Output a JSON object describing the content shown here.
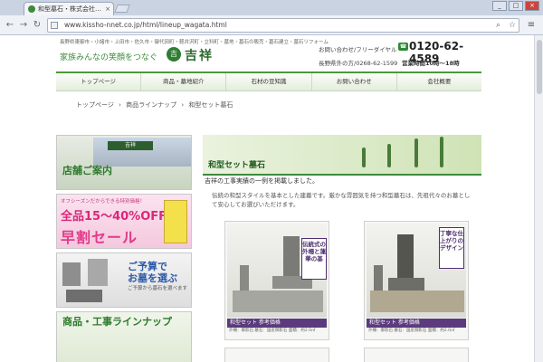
{
  "browser": {
    "tab_title": "和型墓石・株式会社…",
    "tab_close": "×",
    "url": "www.kissho-nnet.co.jp/html/lineup_wagata.html",
    "nav": {
      "back": "←",
      "forward": "→",
      "reload": "↻"
    },
    "window": {
      "minimize": "_",
      "maximize": "□",
      "close": "×"
    }
  },
  "site": {
    "tagline_small": "長野県東御市・小諸市・上田市・佐久市・御代田町・軽井沢町・立科町・墓地・墓石の販売・墓石建立・墓石リフォーム",
    "slogan": "家族みんなの笑顔をつなぐ",
    "logo_mark": "吉",
    "logo_text": "吉祥",
    "phone_label": "お問い合わせ/フリーダイヤル",
    "phone_icon": "☎",
    "phone_number": "0120-62-4589",
    "store_info": "長野県外の方/0268-62-1599",
    "store_hours": "営業時間10時〜18時",
    "nav": [
      "トップページ",
      "商品・墓地紹介",
      "石材の豆知識",
      "お問い合わせ",
      "会社概要"
    ],
    "breadcrumb": [
      "トップページ",
      "›",
      "商品ラインナップ",
      "›",
      "和型セット墓石"
    ]
  },
  "sidebar": {
    "store_sign": "吉祥",
    "store_label": "店舗ご案内",
    "sale_line1": "オフシーズンだからできる特別価格！",
    "sale_line2": "全品15〜40%OFF!",
    "sale_line3": "早割セール",
    "budget_label_1": "ご予算で",
    "budget_label_2": "お墓を選ぶ",
    "budget_sub": "ご予算から墓石を選べます",
    "lineup_label": "商品・工事ラインナップ"
  },
  "main": {
    "hero_title": "和型セット墓石",
    "intro": "吉祥の工事実績の一例を掲載しました。",
    "desc": "伝統の和型スタイルを基本とした建墓です。厳かな雰囲気を持つ和型墓石は、先祖代々のお墓として安心してお選びいただけます。",
    "products": [
      {
        "badge": "伝統式の外柵と蓮華の基",
        "name": "和型セット 参考価格",
        "spec": "外柵：御影石 墓石：国産御影石 面積：約2.0㎡"
      },
      {
        "badge": "丁寧な仕上がりのデザイン",
        "name": "和型セット 参考価格",
        "spec": "外柵：御影石 墓石：国産御影石 面積：約2.0㎡"
      }
    ]
  },
  "icons": {
    "star": "☆",
    "menu": "≡"
  },
  "colors": {
    "brand_green": "#3d8a3d",
    "sale_pink": "#d9287a",
    "badge_purple": "#5b3b7e"
  }
}
